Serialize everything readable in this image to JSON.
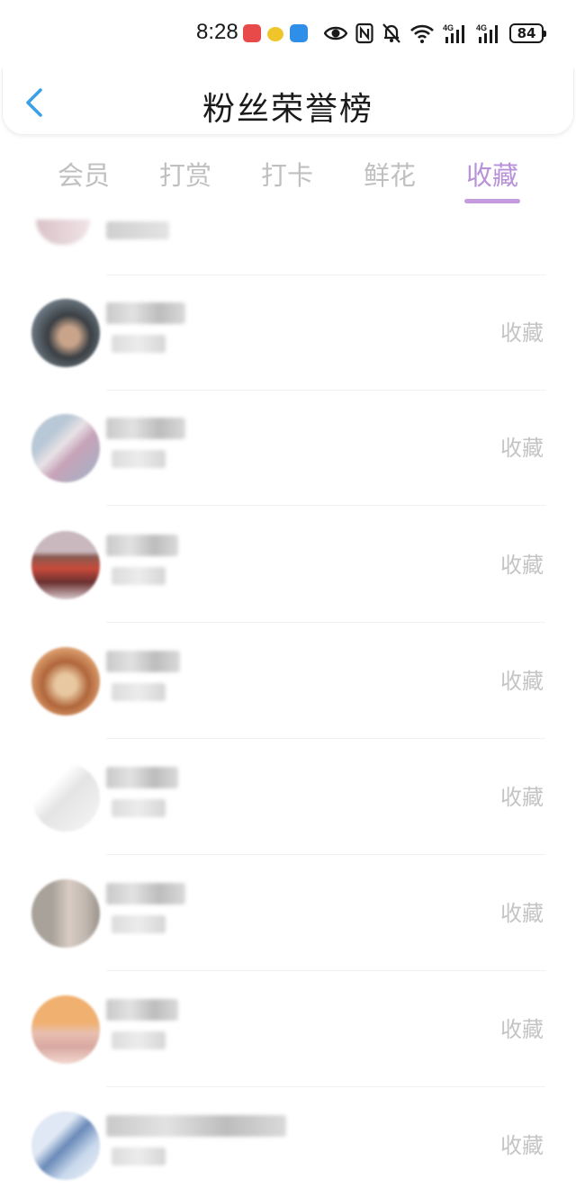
{
  "status_bar": {
    "time": "8:28",
    "battery": "84",
    "icons": [
      "eye-icon",
      "nfc-icon",
      "mute-bell-icon",
      "wifi-icon",
      "4g-signal-icon",
      "4g-signal-icon"
    ]
  },
  "header": {
    "title": "粉丝荣誉榜",
    "back_icon": "chevron-left-icon"
  },
  "tabs": [
    {
      "label": "会员",
      "active": false
    },
    {
      "label": "打赏",
      "active": false
    },
    {
      "label": "打卡",
      "active": false
    },
    {
      "label": "鲜花",
      "active": false
    },
    {
      "label": "收藏",
      "active": true
    }
  ],
  "colors": {
    "accent": "#c59be0",
    "accent_text": "#b892d8",
    "inactive_tab": "#c0c0c0",
    "action_text": "#c4c4c4"
  },
  "list": {
    "items": [
      {
        "action": "收藏"
      },
      {
        "action": "收藏"
      },
      {
        "action": "收藏"
      },
      {
        "action": "收藏"
      },
      {
        "action": "收藏"
      },
      {
        "action": "收藏"
      },
      {
        "action": "收藏"
      },
      {
        "action": "收藏"
      }
    ]
  }
}
